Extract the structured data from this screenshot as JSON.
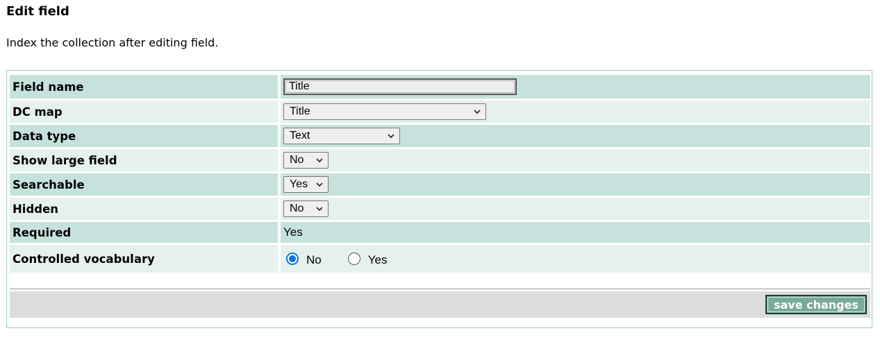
{
  "page": {
    "title": "Edit field",
    "intro": "Index the collection after editing field."
  },
  "form": {
    "field_name": {
      "label": "Field name",
      "value": "Title"
    },
    "dc_map": {
      "label": "DC map",
      "selected": "Title"
    },
    "data_type": {
      "label": "Data type",
      "selected": "Text"
    },
    "show_large_field": {
      "label": "Show large field",
      "selected": "No"
    },
    "searchable": {
      "label": "Searchable",
      "selected": "Yes"
    },
    "hidden": {
      "label": "Hidden",
      "selected": "No"
    },
    "required": {
      "label": "Required",
      "value": "Yes"
    },
    "controlled_vocabulary": {
      "label": "Controlled vocabulary",
      "options": [
        "No",
        "Yes"
      ],
      "selected": "No"
    }
  },
  "footer": {
    "save_label": "save changes"
  },
  "colors": {
    "row_dark": "#c6e2dc",
    "row_light": "#e6f1ee",
    "button_bg": "#78aa9a",
    "radio_accent": "#0a74e0"
  }
}
